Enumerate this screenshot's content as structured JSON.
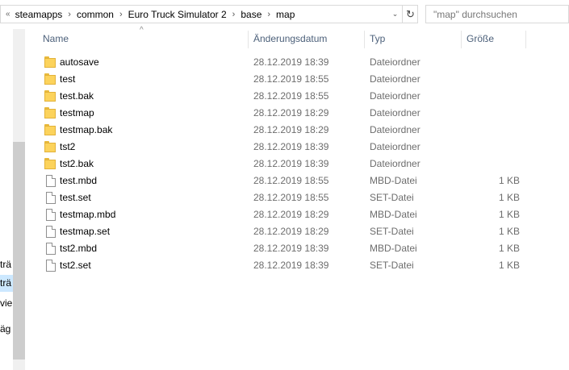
{
  "address": {
    "lead": "«",
    "crumbs": [
      "steamapps",
      "common",
      "Euro Truck Simulator 2",
      "base",
      "map"
    ],
    "separator": "›",
    "dropdown": "⌄",
    "refresh": "↻"
  },
  "search": {
    "placeholder": "\"map\" durchsuchen"
  },
  "navpane": {
    "labels": [
      "trä",
      "trä",
      "vie",
      "äg"
    ]
  },
  "columns": {
    "name": "Name",
    "date": "Änderungsdatum",
    "type": "Typ",
    "size": "Größe"
  },
  "sort_indicator": "^",
  "files": [
    {
      "kind": "folder",
      "name": "autosave",
      "date": "28.12.2019 18:39",
      "type": "Dateiordner",
      "size": ""
    },
    {
      "kind": "folder",
      "name": "test",
      "date": "28.12.2019 18:55",
      "type": "Dateiordner",
      "size": ""
    },
    {
      "kind": "folder",
      "name": "test.bak",
      "date": "28.12.2019 18:55",
      "type": "Dateiordner",
      "size": ""
    },
    {
      "kind": "folder",
      "name": "testmap",
      "date": "28.12.2019 18:29",
      "type": "Dateiordner",
      "size": ""
    },
    {
      "kind": "folder",
      "name": "testmap.bak",
      "date": "28.12.2019 18:29",
      "type": "Dateiordner",
      "size": ""
    },
    {
      "kind": "folder",
      "name": "tst2",
      "date": "28.12.2019 18:39",
      "type": "Dateiordner",
      "size": ""
    },
    {
      "kind": "folder",
      "name": "tst2.bak",
      "date": "28.12.2019 18:39",
      "type": "Dateiordner",
      "size": ""
    },
    {
      "kind": "file",
      "name": "test.mbd",
      "date": "28.12.2019 18:55",
      "type": "MBD-Datei",
      "size": "1 KB"
    },
    {
      "kind": "file",
      "name": "test.set",
      "date": "28.12.2019 18:55",
      "type": "SET-Datei",
      "size": "1 KB"
    },
    {
      "kind": "file",
      "name": "testmap.mbd",
      "date": "28.12.2019 18:29",
      "type": "MBD-Datei",
      "size": "1 KB"
    },
    {
      "kind": "file",
      "name": "testmap.set",
      "date": "28.12.2019 18:29",
      "type": "SET-Datei",
      "size": "1 KB"
    },
    {
      "kind": "file",
      "name": "tst2.mbd",
      "date": "28.12.2019 18:39",
      "type": "MBD-Datei",
      "size": "1 KB"
    },
    {
      "kind": "file",
      "name": "tst2.set",
      "date": "28.12.2019 18:39",
      "type": "SET-Datei",
      "size": "1 KB"
    }
  ]
}
